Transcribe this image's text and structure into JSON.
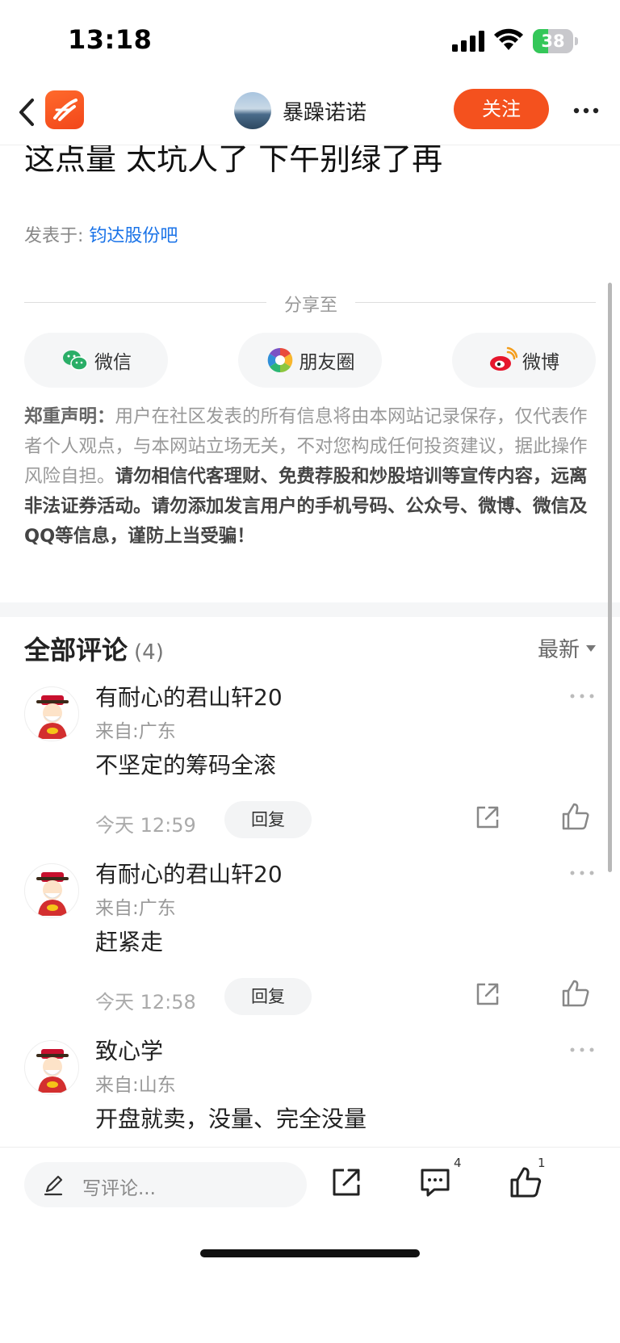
{
  "status_bar": {
    "time": "13:18",
    "battery_level": "38"
  },
  "nav": {
    "author_name": "暴躁诺诺",
    "follow_label": "关注"
  },
  "post": {
    "title": "这点量 太坑人了 下午别绿了再",
    "posted_in_label": "发表于:",
    "bar_name": "钧达股份吧"
  },
  "share": {
    "label": "分享至",
    "wechat": "微信",
    "moments": "朋友圈",
    "weibo": "微博"
  },
  "disclaimer": {
    "lead": "郑重声明：",
    "body": "用户在社区发表的所有信息将由本网站记录保存，仅代表作者个人观点，与本网站立场无关，不对您构成任何投资建议，据此操作风险自担。",
    "warning": "请勿相信代客理财、免费荐股和炒股培训等宣传内容，远离非法证券活动。请勿添加发言用户的手机号码、公众号、微博、微信及QQ等信息，谨防上当受骗！"
  },
  "comments": {
    "title": "全部评论",
    "count": "(4)",
    "sort_label": "最新",
    "reply_label": "回复",
    "items": [
      {
        "name": "有耐心的君山轩20",
        "location": "来自:广东",
        "text": "不坚定的筹码全滚",
        "time": "今天 12:59"
      },
      {
        "name": "有耐心的君山轩20",
        "location": "来自:广东",
        "text": "赶紧走",
        "time": "今天 12:58"
      },
      {
        "name": "致心学",
        "location": "来自:山东",
        "text": "开盘就卖，没量、完全没量",
        "time": ""
      }
    ]
  },
  "bottom_bar": {
    "input_placeholder": "写评论...",
    "comment_count": "4",
    "like_count": "1"
  },
  "colors": {
    "accent": "#f4511e",
    "link": "#1a73e8"
  }
}
